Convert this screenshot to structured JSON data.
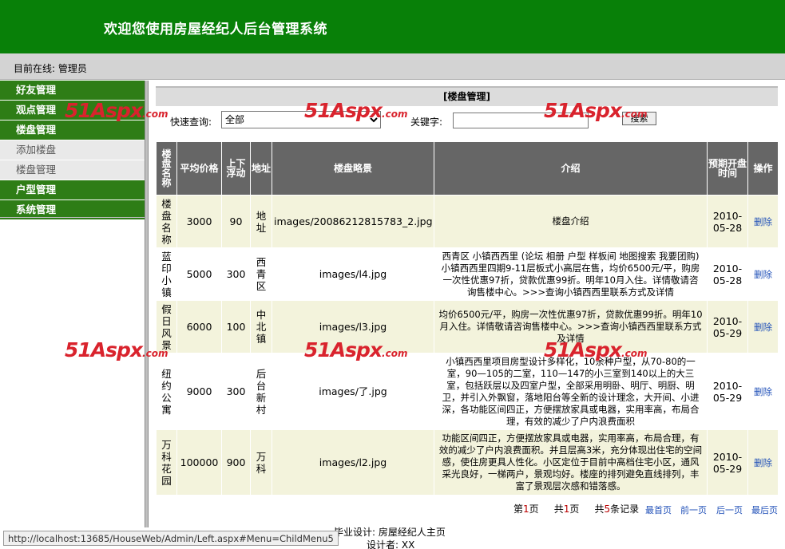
{
  "header": {
    "title": "欢迎您使用房屋经纪人后台管理系统"
  },
  "online": {
    "text": "目前在线: 管理员"
  },
  "menu": [
    {
      "type": "head",
      "label": "好友管理"
    },
    {
      "type": "head",
      "label": "观点管理"
    },
    {
      "type": "head",
      "label": "楼盘管理"
    },
    {
      "type": "sub",
      "label": "添加楼盘"
    },
    {
      "type": "sub",
      "label": "楼盘管理"
    },
    {
      "type": "head",
      "label": "户型管理"
    },
    {
      "type": "head",
      "label": "系统管理"
    }
  ],
  "section_title": "[楼盘管理]",
  "search": {
    "quick_label": "快速查询:",
    "select_value": "全部",
    "keyword_label": "关键字:",
    "keyword_value": "",
    "button_label": "搜索"
  },
  "table": {
    "headers": [
      "楼盘名称",
      "平均价格",
      "上下浮动",
      "地址",
      "楼盘略景",
      "介绍",
      "预期开盘时间",
      "操作"
    ],
    "rows": [
      {
        "name": "楼盘名称",
        "price": "3000",
        "float": "90",
        "address": "地址",
        "image": "images/20086212815783_2.jpg",
        "intro": "楼盘介绍",
        "date": "2010-05-28",
        "action": "删除"
      },
      {
        "name": "蓝印小镇",
        "price": "5000",
        "float": "300",
        "address": "西青区",
        "image": "images/l4.jpg",
        "intro": "西青区 小镇西西里 (论坛 相册 户型 样板间 地图搜索 我要团购)小镇西西里四期9-11层板式小高层在售，均价6500元/平，购房一次性优惠97折，贷款优惠99折。明年10月入住。详情敬请咨询售楼中心。>>>查询小镇西西里联系方式及详情",
        "date": "2010-05-28",
        "action": "删除"
      },
      {
        "name": "假日风景",
        "price": "6000",
        "float": "100",
        "address": "中北镇",
        "image": "images/l3.jpg",
        "intro": "均价6500元/平，购房一次性优惠97折，贷款优惠99折。明年10月入住。详情敬请咨询售楼中心。>>>查询小镇西西里联系方式及详情",
        "date": "2010-05-29",
        "action": "删除"
      },
      {
        "name": "纽约公寓",
        "price": "9000",
        "float": "300",
        "address": "后台新村",
        "image": "images/了.jpg",
        "intro": "小镇西西里项目房型设计多样化，10余种户型，从70-80的一室，90—105的二室，110—147的小三室到140以上的大三室，包括跃层以及四室户型，全部采用明卧、明厅、明厨、明卫，并引入外飘窗，落地阳台等全新的设计理念，大开间、小进深，各功能区间四正，方便摆放家具或电器，实用率高，布局合理，有效的减少了户内浪费面积",
        "date": "2010-05-29",
        "action": "删除"
      },
      {
        "name": "万科花园",
        "price": "100000",
        "float": "900",
        "address": "万科",
        "image": "images/l2.jpg",
        "intro": "功能区间四正，方便摆放家具或电器，实用率高，布局合理，有效的减少了户内浪费面积。并且层高3米，充分体现出住宅的空间感，使住房更具人性化。小区定位于目前中高档住宅小区，通风采光良好，一梯两户，景观均好。楼座的排列避免直线排列，丰富了景观层次感和错落感。",
        "date": "2010-05-29",
        "action": "删除"
      }
    ]
  },
  "pager": {
    "page_prefix": "第",
    "page_num": "1",
    "page_suffix": "页",
    "total_prefix": "共",
    "total_pages": "1",
    "total_suffix": "页",
    "records_prefix": "共",
    "records_num": "5",
    "records_suffix": "条记录",
    "first": "最首页",
    "prev": "前一页",
    "next": "后一页",
    "last": "最后页"
  },
  "footer": {
    "line1": "毕业设计: 房屋经纪人主页",
    "line2": "设计者: XX"
  },
  "status_url": "http://localhost:13685/HouseWeb/Admin/Left.aspx#Menu=ChildMenu5",
  "watermark": {
    "brand": "51Aspx",
    "suffix": ".com"
  }
}
